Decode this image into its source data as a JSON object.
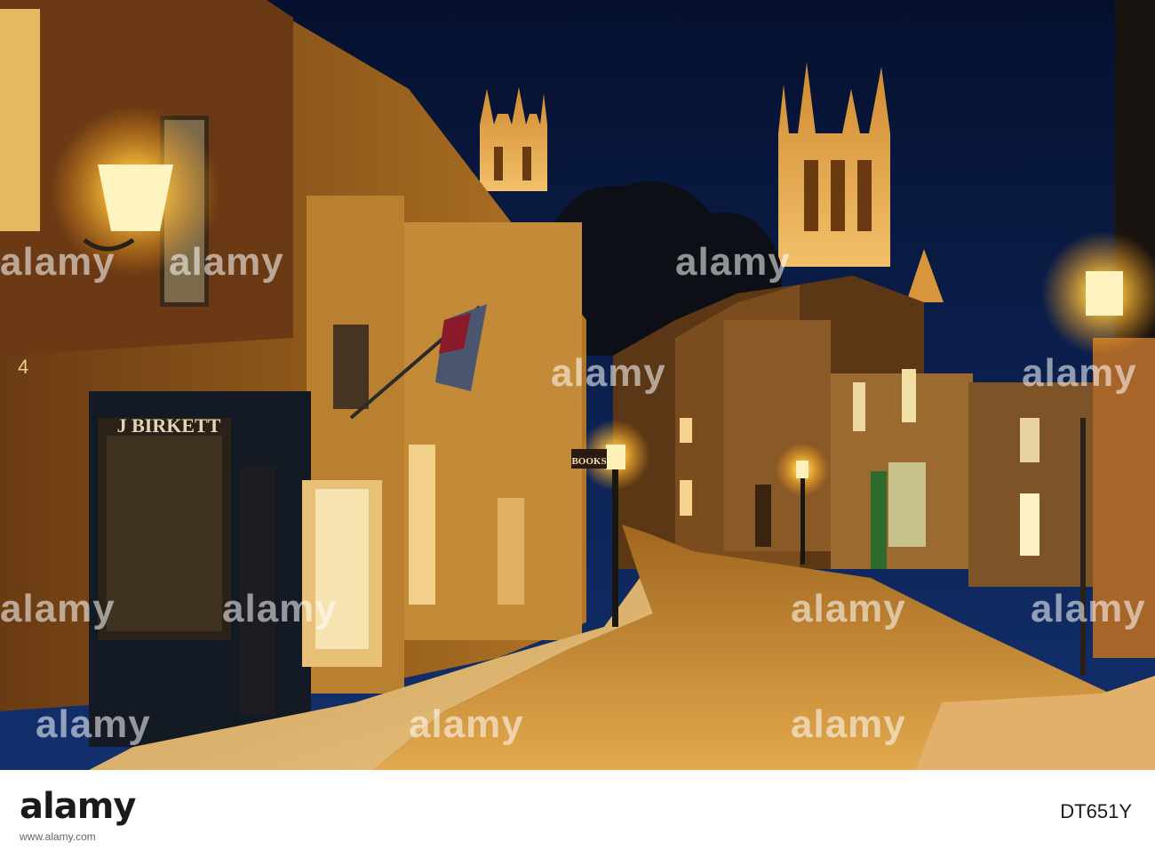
{
  "scene": {
    "shop_sign": "J BIRKETT",
    "books_sign": "BOOKS",
    "door_number": "4"
  },
  "watermarks": [
    "alamy",
    "alamy",
    "alamy",
    "alamy",
    "alamy",
    "alamy",
    "alamy",
    "alamy",
    "alamy",
    "alamy",
    "alamy",
    "alamy"
  ],
  "footer": {
    "logo": "alamy",
    "image_id": "DT651Y",
    "url": "www.alamy.com"
  },
  "colors": {
    "sky": "#0b1d4a",
    "lamp_glow": "#ffc23a",
    "stone_lit": "#c98a2e"
  }
}
